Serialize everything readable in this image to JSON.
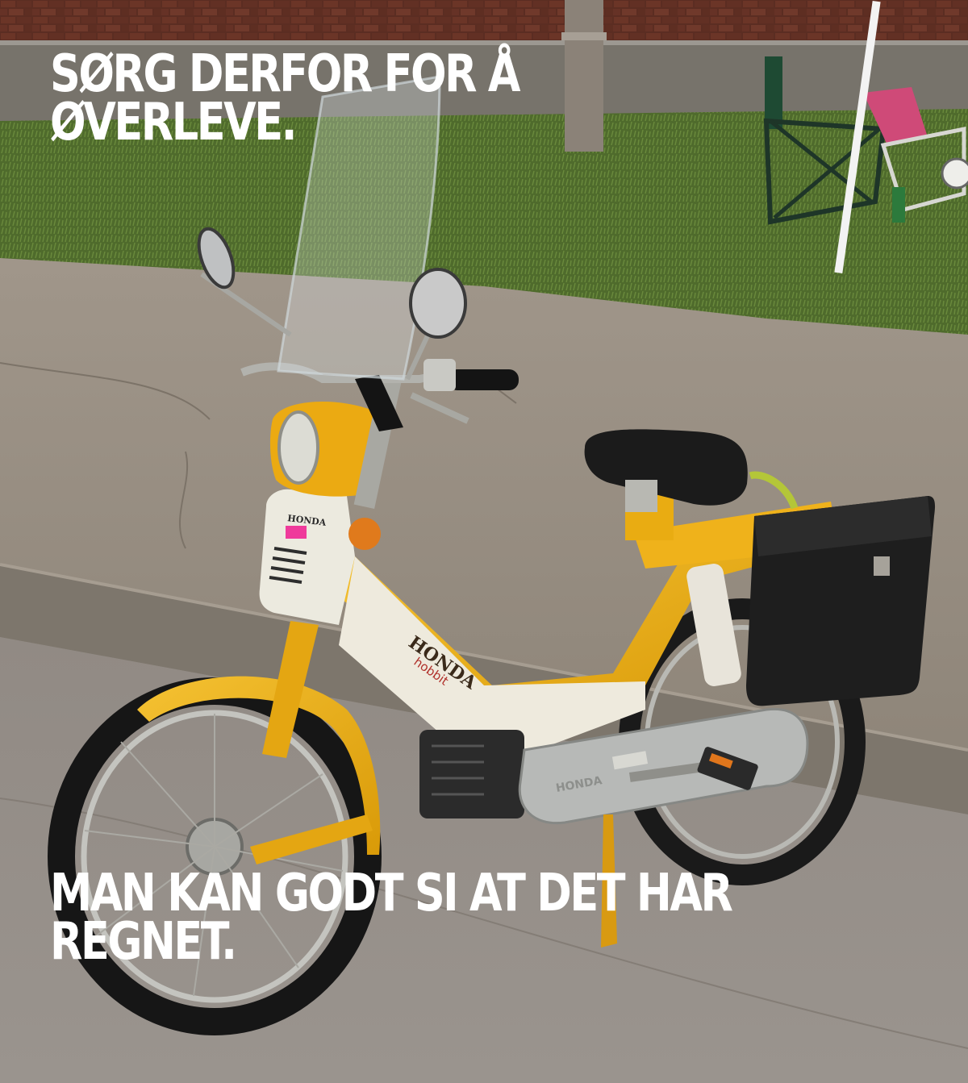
{
  "meme": {
    "top_text": "SØRG DERFOR FOR Å ØVERLEVE.",
    "bottom_text": "MAN KAN GODT SI AT DET HAR REGNET."
  },
  "photo": {
    "fairing_badge": "HONDA",
    "side_panel_brand": "HONDA",
    "side_panel_model": "hobbit",
    "engine_cover_brand": "HONDA"
  },
  "colors": {
    "moped_yellow": "#e9ac12",
    "panel_white": "#eeeadd",
    "seat_black": "#1b1b1b",
    "pavement": "#958c80",
    "grass": "#4f6b2c",
    "brick": "#5b2d22",
    "caption": "#ffffff"
  }
}
